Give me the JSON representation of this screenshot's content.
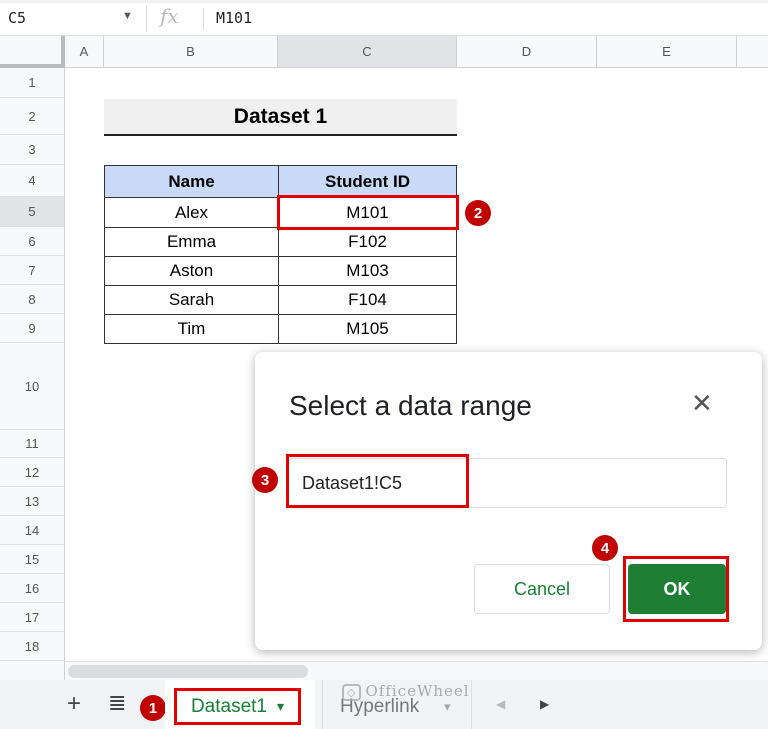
{
  "formula_bar": {
    "cell_ref": "C5",
    "fx": "fx",
    "value": "M101"
  },
  "columns": [
    "A",
    "B",
    "C",
    "D",
    "E"
  ],
  "rows": [
    "1",
    "2",
    "3",
    "4",
    "5",
    "6",
    "7",
    "8",
    "9",
    "10",
    "11",
    "12",
    "13",
    "14",
    "15",
    "16",
    "17",
    "18"
  ],
  "table": {
    "title": "Dataset 1",
    "headers": [
      "Name",
      "Student ID"
    ],
    "rows": [
      [
        "Alex",
        "M101"
      ],
      [
        "Emma",
        "F102"
      ],
      [
        "Aston",
        "M103"
      ],
      [
        "Sarah",
        "F104"
      ],
      [
        "Tim",
        "M105"
      ]
    ]
  },
  "dialog": {
    "title": "Select a data range",
    "close": "✕",
    "range_value": "Dataset1!C5",
    "cancel": "Cancel",
    "ok": "OK"
  },
  "badges": [
    "1",
    "2",
    "3",
    "4"
  ],
  "sheets": {
    "add": "+",
    "list": "≣",
    "tabs": [
      "Dataset1",
      "Hyperlink"
    ],
    "dropdown": "▾",
    "prev": "◀",
    "next": "▶"
  },
  "watermark": "OfficeWheel",
  "colors": {
    "accent": "#188038",
    "annotation": "#c00000",
    "header_fill": "#c9daf8"
  }
}
